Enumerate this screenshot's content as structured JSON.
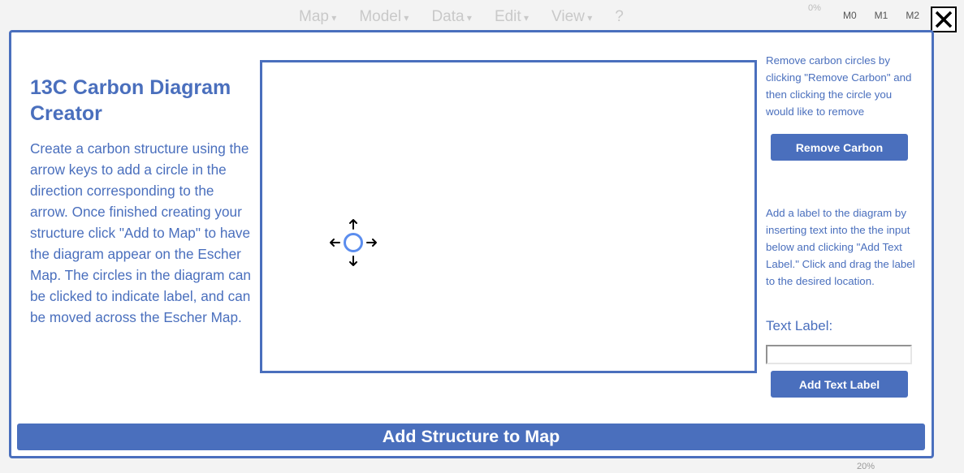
{
  "background": {
    "menu": [
      "Map",
      "Model",
      "Data",
      "Edit",
      "View",
      "?"
    ],
    "stats_text": "0%",
    "columns": [
      "M0",
      "M1",
      "M2"
    ],
    "bottom_text": "20%"
  },
  "modal": {
    "title": "13C Carbon Diagram Creator",
    "description": "Create a carbon structure using the arrow keys to add a circle in the direction corresponding to the arrow. Once finished creating your structure click \"Add to Map\" to have the diagram appear on the Escher Map. The circles in the diagram can be clicked to indicate label, and can be moved across the Escher Map.",
    "remove_help": "Remove carbon circles by clicking \"Remove Carbon\" and then clicking the circle you would like to remove",
    "remove_button": "Remove Carbon",
    "label_help": "Add a label to the diagram by inserting text into the the input below and clicking \"Add Text Label.\" Click and drag the label to the desired location.",
    "text_label_caption": "Text Label:",
    "text_label_value": "",
    "add_label_button": "Add Text Label",
    "add_structure_button": "Add Structure to Map"
  },
  "icons": {
    "close": "close-icon",
    "carbon_cursor": "move-arrows-icon",
    "accent_color": "#4a6fbd",
    "carbon_color": "#5b8dee"
  }
}
